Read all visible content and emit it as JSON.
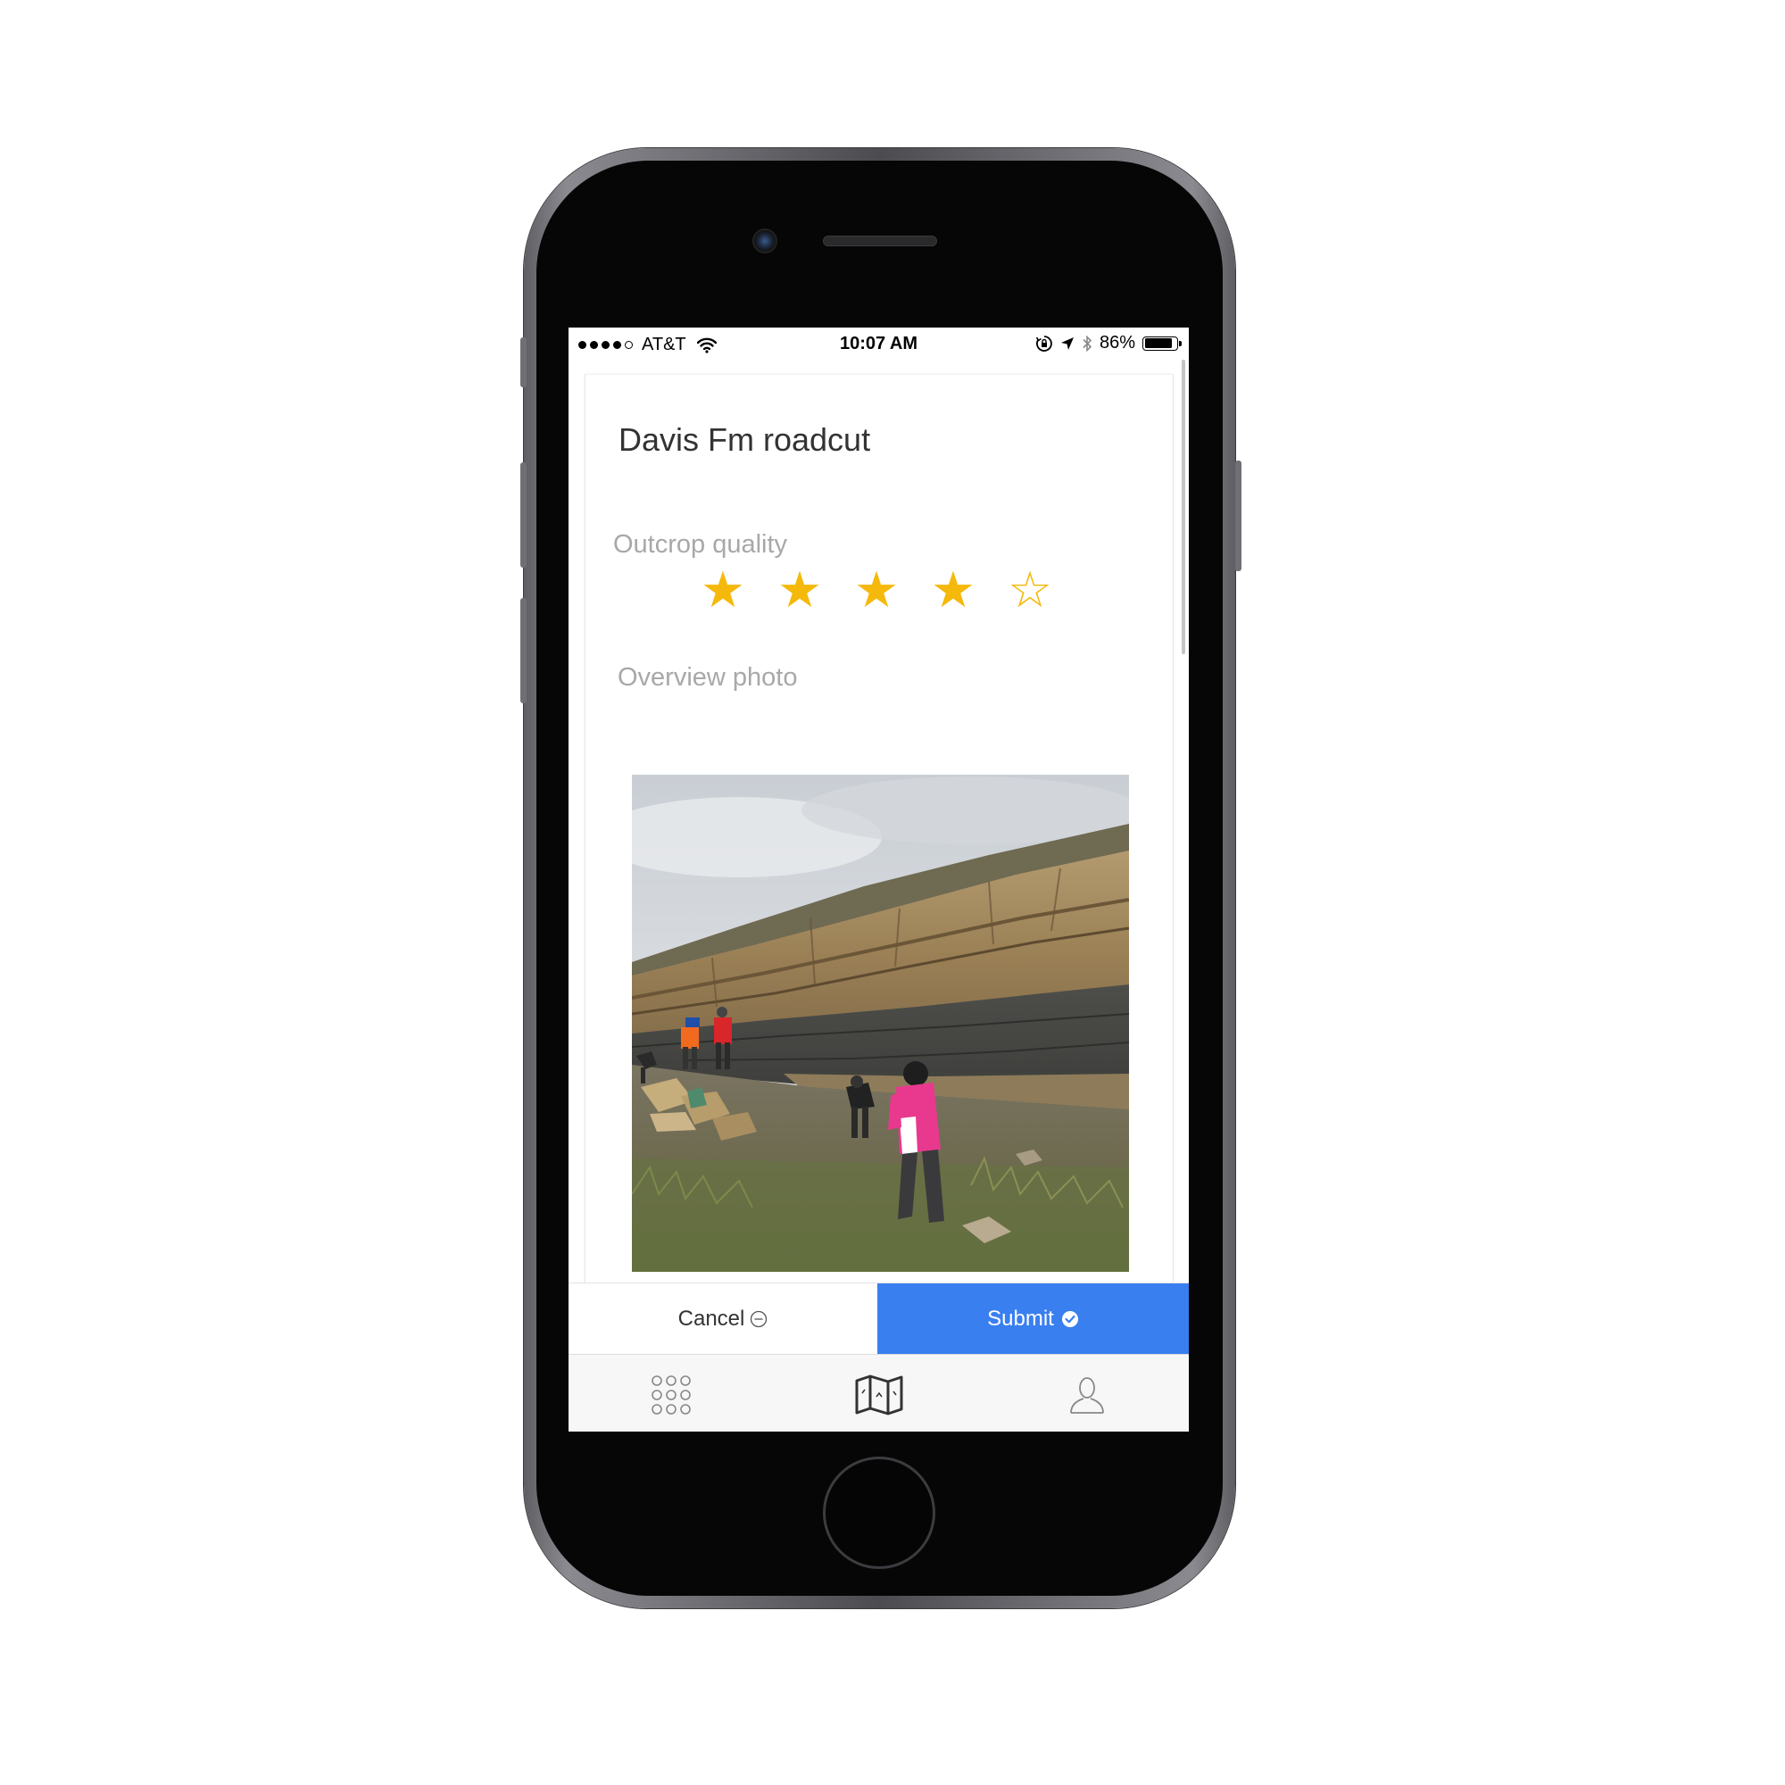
{
  "status_bar": {
    "carrier": "AT&T",
    "time": "10:07 AM",
    "battery_percent": "86%",
    "battery_level": 0.86,
    "signal_bars_filled": 4,
    "signal_bars_total": 5
  },
  "record": {
    "title": "Davis Fm roadcut"
  },
  "fields": {
    "quality_label": "Outcrop quality",
    "quality_rating": 4,
    "quality_max": 5,
    "photo_label": "Overview photo"
  },
  "actions": {
    "cancel_label": "Cancel",
    "submit_label": "Submit"
  },
  "tab_bar": {
    "items": [
      {
        "icon": "grid-icon"
      },
      {
        "icon": "map-icon",
        "active": true
      },
      {
        "icon": "profile-icon"
      }
    ]
  },
  "colors": {
    "accent": "#3a7ff0",
    "star": "#f5b90b",
    "label": "#a8a8a8"
  }
}
